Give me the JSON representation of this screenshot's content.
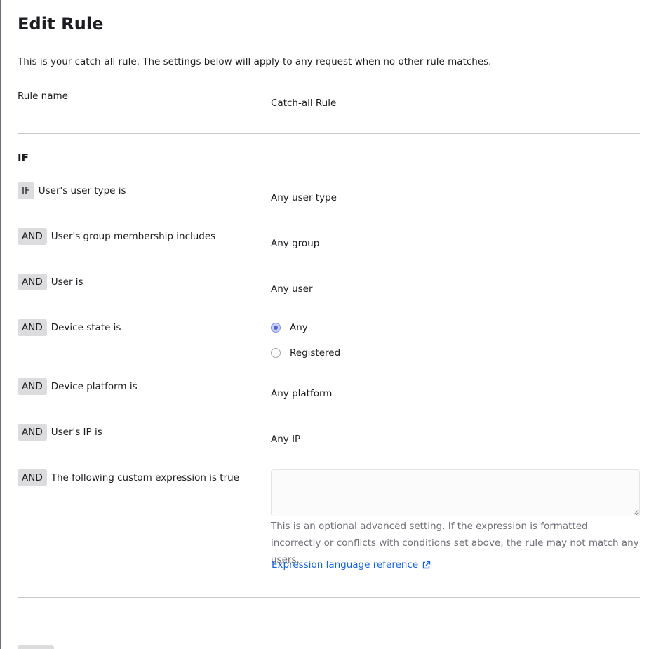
{
  "header": {
    "title": "Edit Rule",
    "description": "This is your catch-all rule. The settings below will apply to any request when no other rule matches."
  },
  "rule_name": {
    "label": "Rule name",
    "value": "Catch-all Rule"
  },
  "conditions": {
    "section_title": "IF",
    "user_type": {
      "operator": "IF",
      "label": "User's user type is",
      "value": "Any user type"
    },
    "group": {
      "operator": "AND",
      "label": "User's group membership includes",
      "value": "Any group"
    },
    "user": {
      "operator": "AND",
      "label": "User is",
      "value": "Any user"
    },
    "device_state": {
      "operator": "AND",
      "label": "Device state is",
      "options": [
        "Any",
        "Registered"
      ],
      "selected": "Any"
    },
    "platform": {
      "operator": "AND",
      "label": "Device platform is",
      "value": "Any platform"
    },
    "ip": {
      "operator": "AND",
      "label": "User's IP is",
      "value": "Any IP"
    },
    "custom_expression": {
      "operator": "AND",
      "label": "The following custom expression is true",
      "value": "",
      "help": "This is an optional advanced setting. If the expression is formatted incorrectly or conflicts with conditions set above, the rule may not match any users.",
      "link_label": "Expression language reference"
    }
  },
  "icons": {
    "radio_selected": "radio-selected-icon",
    "external_link": "external-link-icon"
  },
  "colors": {
    "link": "#1662dd",
    "chip_bg": "#dcdcde",
    "radio_selected": "#4c64d6",
    "divider": "#c8c8cd"
  }
}
